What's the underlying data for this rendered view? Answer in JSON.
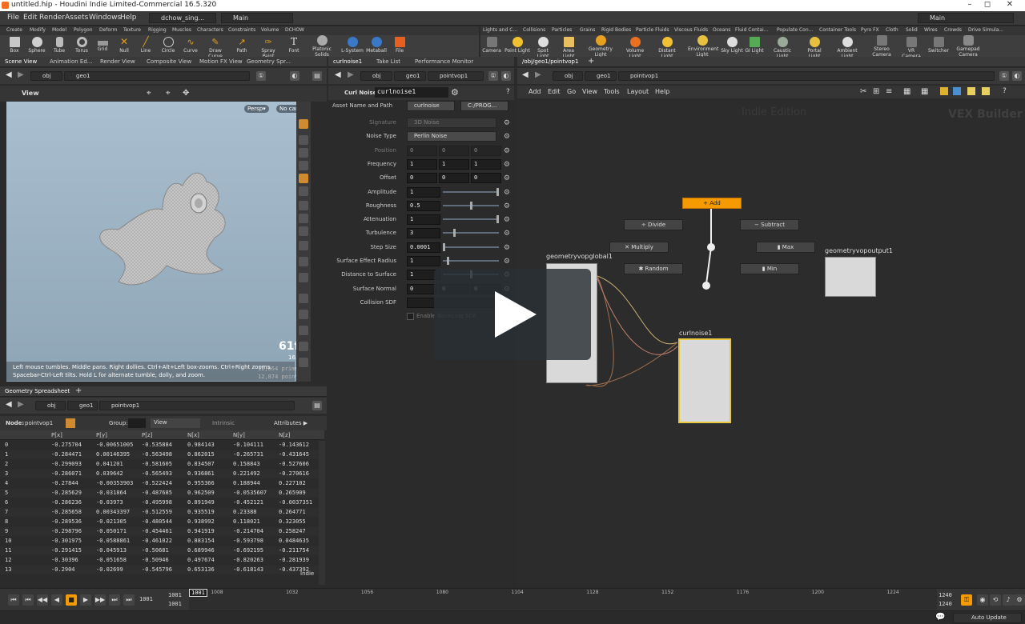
{
  "window": {
    "title": "untitled.hip - Houdini Indie Limited-Commercial 16.5.320",
    "min": "–",
    "max": "◻",
    "close": "✕"
  },
  "menu": {
    "items": [
      "File",
      "Edit",
      "Render",
      "Assets",
      "Windows",
      "Help"
    ],
    "desktop": "dchow_sing...",
    "main": "Main",
    "right_main": "Main"
  },
  "shelf_left": {
    "tabs": [
      "Create",
      "Modify",
      "Model",
      "Polygon",
      "Deform",
      "Texture",
      "Rigging",
      "Muscles",
      "Characters",
      "Constraints",
      "Volume",
      "DCHOW"
    ],
    "tools": [
      "Box",
      "Sphere",
      "Tube",
      "Torus",
      "Grid",
      "Null",
      "Line",
      "Circle",
      "Curve",
      "Draw Curve",
      "Path",
      "Spray Paint",
      "Font",
      "Platonic Solids",
      "L-System",
      "Metaball",
      "File"
    ]
  },
  "shelf_right": {
    "tabs": [
      "Lights and C...",
      "Collisions",
      "Particles",
      "Grains",
      "Rigid Bodies",
      "Particle Fluids",
      "Viscous Fluids",
      "Oceans",
      "Fluid Contai...",
      "Populate Con...",
      "Container Tools",
      "Pyro FX",
      "Cloth",
      "Solid",
      "Wires",
      "Crowds",
      "Drive Simula..."
    ],
    "tools": [
      "Camera",
      "Point Light",
      "Spot Light",
      "Area Light",
      "Geometry Light",
      "Volume Light",
      "Distant Light",
      "Environment Light",
      "Sky Light",
      "GI Light",
      "Caustic Light",
      "Portal Light",
      "Ambient Light",
      "Stereo Camera",
      "VR Camera",
      "Switcher",
      "Gamepad Camera"
    ]
  },
  "viewer": {
    "tabs": [
      "Scene View",
      "Animation Ed...",
      "Render View",
      "Composite View",
      "Motion FX View",
      "Geometry Spr..."
    ],
    "path": [
      "obj",
      "geo1"
    ],
    "label": "View",
    "persp": "Persp▾",
    "cam": "No cam▾",
    "fps": "61fps",
    "ms": "16.27ms",
    "prims": "12,854  prims",
    "points": "12,874  points",
    "help": "Left mouse tumbles. Middle pans. Right dollies. Ctrl+Alt+Left box-zooms. Ctrl+Right zooms. Spacebar-Ctrl-Left tilts. Hold L for alternate tumble, dolly, and zoom."
  },
  "spreadsheet": {
    "tab": "Geometry Spreadsheet",
    "path": [
      "obj",
      "geo1",
      "pointvop1"
    ],
    "node_label": "Node:",
    "node": "pointvop1",
    "group_label": "Group:",
    "view": "View",
    "intrinsics": "Intrinsic",
    "attributes": "Attributes ▶",
    "indie": "Indie",
    "columns": [
      "",
      "P[x]",
      "P[y]",
      "P[z]",
      "N[x]",
      "N[y]",
      "N[z]"
    ],
    "rows": [
      [
        "0",
        "-0.275704",
        "-0.00651005",
        "-0.535884",
        "0.984143",
        "-0.104111",
        "-0.143612"
      ],
      [
        "1",
        "-0.284471",
        "0.00146395",
        "-0.563498",
        "0.862015",
        "-0.265731",
        "-0.431645"
      ],
      [
        "2",
        "-0.299093",
        "0.041201",
        "-0.581605",
        "0.834507",
        "0.158843",
        "-0.527606"
      ],
      [
        "3",
        "-0.286071",
        "0.039642",
        "-0.565493",
        "0.936861",
        "0.221492",
        "-0.270616"
      ],
      [
        "4",
        "-0.27844",
        "-0.00353903",
        "-0.522424",
        "0.955366",
        "0.188944",
        "0.227102"
      ],
      [
        "5",
        "-0.285629",
        "-0.031864",
        "-0.487685",
        "0.962509",
        "-0.0535607",
        "0.265909"
      ],
      [
        "6",
        "-0.286236",
        "-0.03973",
        "-0.495998",
        "0.891949",
        "-0.452121",
        "-0.0037351"
      ],
      [
        "7",
        "-0.285658",
        "0.00343397",
        "-0.512559",
        "0.935519",
        "0.23388",
        "0.264771"
      ],
      [
        "8",
        "-0.289536",
        "-0.021305",
        "-0.480544",
        "0.938992",
        "0.118021",
        "0.323055"
      ],
      [
        "9",
        "-0.298796",
        "-0.050171",
        "-0.454461",
        "0.941919",
        "-0.214704",
        "0.258247"
      ],
      [
        "10",
        "-0.301975",
        "-0.0588861",
        "-0.461022",
        "0.883154",
        "-0.593798",
        "0.0484635"
      ],
      [
        "11",
        "-0.291415",
        "-0.045913",
        "-0.50681",
        "0.689946",
        "-0.692195",
        "-0.211754"
      ],
      [
        "12",
        "-0.30396",
        "-0.051658",
        "-0.50946",
        "0.497674",
        "-0.820263",
        "-0.281939"
      ],
      [
        "13",
        "-0.2904",
        "-0.02699",
        "-0.545796",
        "0.653136",
        "-0.618143",
        "-0.437392"
      ]
    ]
  },
  "params": {
    "tabs": [
      "curlnoise1",
      "Take List",
      "Performance Monitor"
    ],
    "path": [
      "obj",
      "geo1",
      "pointvop1"
    ],
    "type": "Curl Noise",
    "name": "curlnoise1",
    "asset_label": "Asset Name and Path",
    "asset": "curlnoise",
    "asset_path": "C:/PROG...",
    "rows": [
      {
        "label": "Signature",
        "value": "3D Noise",
        "kind": "menu",
        "disabled": true
      },
      {
        "label": "Noise Type",
        "value": "Perlin Noise",
        "kind": "menu"
      },
      {
        "label": "Position",
        "kind": "vec",
        "values": [
          "0",
          "0",
          "0"
        ],
        "disabled": true
      },
      {
        "label": "Frequency",
        "kind": "vec",
        "values": [
          "1",
          "1",
          "1"
        ]
      },
      {
        "label": "Offset",
        "kind": "vec",
        "values": [
          "0",
          "0",
          "0"
        ]
      },
      {
        "label": "Amplitude",
        "value": "1",
        "kind": "slider",
        "fraction": 1.0
      },
      {
        "label": "Roughness",
        "value": "0.5",
        "kind": "slider",
        "fraction": 0.5
      },
      {
        "label": "Attenuation",
        "value": "1",
        "kind": "slider",
        "fraction": 1.0
      },
      {
        "label": "Turbulence",
        "value": "3",
        "kind": "slider",
        "fraction": 0.2
      },
      {
        "label": "Step Size",
        "value": "0.0001",
        "kind": "slider",
        "fraction": 0.0
      },
      {
        "label": "Surface Effect Radius",
        "value": "1",
        "kind": "slider",
        "fraction": 0.08
      },
      {
        "label": "Distance to Surface",
        "value": "1",
        "kind": "slider",
        "fraction": 0.5
      },
      {
        "label": "Surface Normal",
        "kind": "vec",
        "values": [
          "0",
          "0",
          "0"
        ]
      },
      {
        "label": "Collision SDF",
        "value": "",
        "kind": "text"
      }
    ],
    "checkbox": "Enable Bouncing SDF"
  },
  "network": {
    "tab": "/obj/geo1/pointvop1",
    "path": [
      "obj",
      "geo1",
      "pointvop1"
    ],
    "menu": [
      "Add",
      "Edit",
      "Go",
      "View",
      "Tools",
      "Layout",
      "Help"
    ],
    "watermark1": "Indie Edition",
    "watermark2": "VEX Builder",
    "buttons": {
      "add": "+ Add",
      "divide": "÷ Divide",
      "subtract": "− Subtract",
      "multiply": "✕ Multiply",
      "max": "▮ Max",
      "random": "✱ Random",
      "min": "▮ Min"
    },
    "nodes": {
      "global": "geometryvopglobal1",
      "output": "geometryvopoutput1",
      "curl": "curlnoise1"
    }
  },
  "timeline": {
    "current": "1001",
    "start": "1001",
    "start2": "1001",
    "ticks": [
      "1008",
      "1032",
      "1056",
      "1080",
      "1104",
      "1128",
      "1152",
      "1176",
      "1200",
      "1224"
    ],
    "end": "1240",
    "end2": "1240"
  },
  "status": {
    "auto_update": "Auto Update"
  },
  "colors": {
    "accent": "#f59a00",
    "node_selected": "#e8c840"
  }
}
